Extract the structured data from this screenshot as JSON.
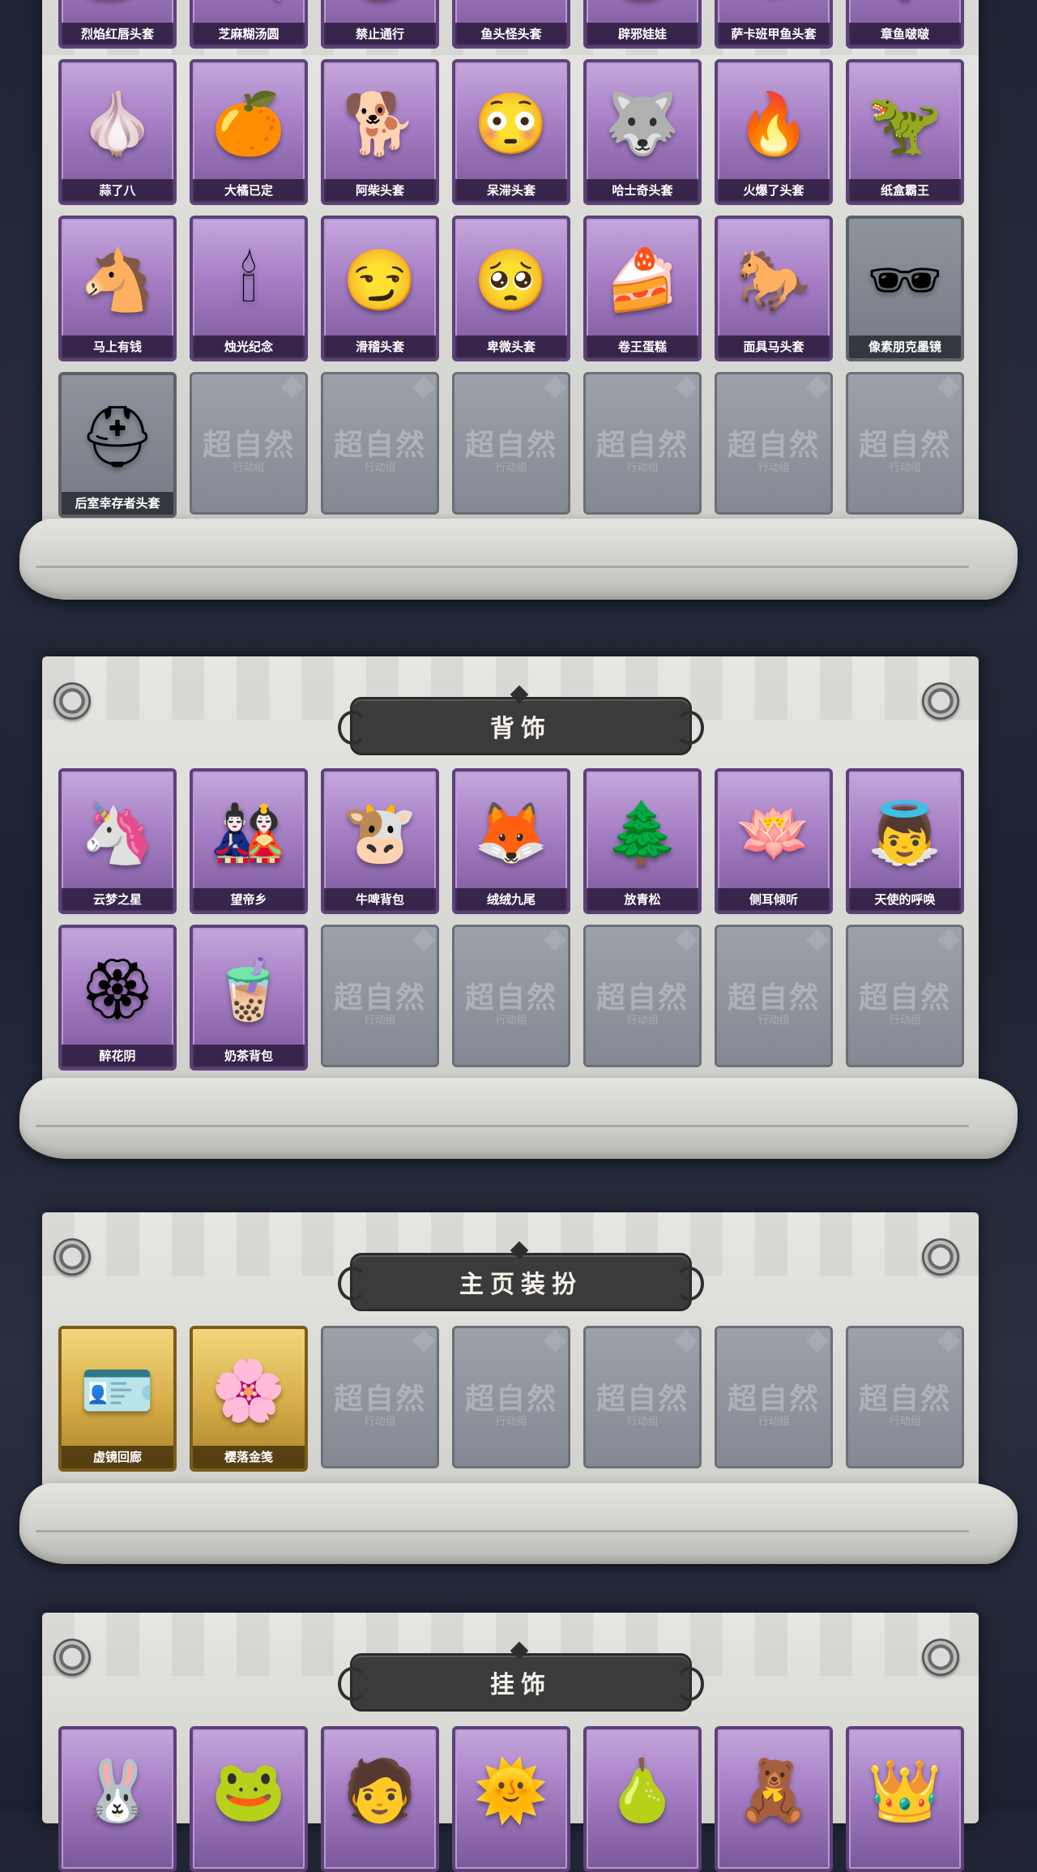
{
  "watermark": {
    "brand": "超自然",
    "sub": "行动组"
  },
  "sections": [
    {
      "id": "headgear",
      "rows": [
        [
          {
            "label": "烈焰红唇头套",
            "icon": "lips-icon",
            "glyph": "💋",
            "rarity": "purple"
          },
          {
            "label": "芝麻糊汤圆",
            "icon": "dumpling-icon",
            "glyph": "🍡",
            "rarity": "purple"
          },
          {
            "label": "禁止通行",
            "icon": "no-entry-icon",
            "glyph": "⛔",
            "rarity": "purple"
          },
          {
            "label": "鱼头怪头套",
            "icon": "fish-icon",
            "glyph": "🐟",
            "rarity": "purple"
          },
          {
            "label": "辟邪娃娃",
            "icon": "doll-icon",
            "glyph": "🪆",
            "rarity": "purple"
          },
          {
            "label": "萨卡班甲鱼头套",
            "icon": "fish-head-icon",
            "glyph": "🐠",
            "rarity": "purple"
          },
          {
            "label": "章鱼啵啵",
            "icon": "octopus-icon",
            "glyph": "🐙",
            "rarity": "purple"
          }
        ],
        [
          {
            "label": "蒜了八",
            "icon": "garlic-icon",
            "glyph": "🧄",
            "rarity": "purple"
          },
          {
            "label": "大橘已定",
            "icon": "orange-icon",
            "glyph": "🍊",
            "rarity": "purple"
          },
          {
            "label": "阿柴头套",
            "icon": "shiba-icon",
            "glyph": "🐕",
            "rarity": "purple"
          },
          {
            "label": "呆滞头套",
            "icon": "dazed-face-icon",
            "glyph": "😳",
            "rarity": "purple"
          },
          {
            "label": "哈士奇头套",
            "icon": "husky-icon",
            "glyph": "🐺",
            "rarity": "purple"
          },
          {
            "label": "火爆了头套",
            "icon": "fire-icon",
            "glyph": "🔥",
            "rarity": "purple"
          },
          {
            "label": "纸盒霸王",
            "icon": "dinosaur-icon",
            "glyph": "🦖",
            "rarity": "purple"
          }
        ],
        [
          {
            "label": "马上有钱",
            "icon": "horse-icon",
            "glyph": "🐴",
            "rarity": "purple"
          },
          {
            "label": "烛光纪念",
            "icon": "candle-icon",
            "glyph": "🕯",
            "rarity": "purple"
          },
          {
            "label": "滑稽头套",
            "icon": "funny-face-icon",
            "glyph": "😏",
            "rarity": "purple"
          },
          {
            "label": "卑微头套",
            "icon": "humble-face-icon",
            "glyph": "🥺",
            "rarity": "purple"
          },
          {
            "label": "卷王蛋糕",
            "icon": "cake-roll-icon",
            "glyph": "🍰",
            "rarity": "purple"
          },
          {
            "label": "面具马头套",
            "icon": "horse-mask-icon",
            "glyph": "🐎",
            "rarity": "purple"
          },
          {
            "label": "像素朋克墨镜",
            "icon": "pixel-glasses-icon",
            "glyph": "🕶",
            "rarity": "gray"
          }
        ],
        [
          {
            "label": "后室幸存者头套",
            "icon": "gas-mask-icon",
            "glyph": "⛑",
            "rarity": "gray"
          },
          {
            "rarity": "empty"
          },
          {
            "rarity": "empty"
          },
          {
            "rarity": "empty"
          },
          {
            "rarity": "empty"
          },
          {
            "rarity": "empty"
          },
          {
            "rarity": "empty"
          }
        ]
      ]
    },
    {
      "id": "back",
      "title": "背饰",
      "rows": [
        [
          {
            "label": "云梦之星",
            "icon": "unicorn-icon",
            "glyph": "🦄",
            "rarity": "purple"
          },
          {
            "label": "望帝乡",
            "icon": "figure-icon",
            "glyph": "🎎",
            "rarity": "purple"
          },
          {
            "label": "牛啤背包",
            "icon": "cow-barrel-icon",
            "glyph": "🐮",
            "rarity": "purple"
          },
          {
            "label": "绒绒九尾",
            "icon": "fox-icon",
            "glyph": "🦊",
            "rarity": "purple"
          },
          {
            "label": "放青松",
            "icon": "pine-tree-icon",
            "glyph": "🌲",
            "rarity": "purple"
          },
          {
            "label": "侧耳倾听",
            "icon": "lotus-wreath-icon",
            "glyph": "🪷",
            "rarity": "purple"
          },
          {
            "label": "天使的呼唤",
            "icon": "angel-icon",
            "glyph": "👼",
            "rarity": "purple"
          }
        ],
        [
          {
            "label": "醉花阴",
            "icon": "flower-ornament-icon",
            "glyph": "🏵",
            "rarity": "purple"
          },
          {
            "label": "奶茶背包",
            "icon": "milk-tea-icon",
            "glyph": "🧋",
            "rarity": "purple"
          },
          {
            "rarity": "empty"
          },
          {
            "rarity": "empty"
          },
          {
            "rarity": "empty"
          },
          {
            "rarity": "empty"
          },
          {
            "rarity": "empty"
          }
        ]
      ]
    },
    {
      "id": "homepage",
      "title": "主页装扮",
      "rows": [
        [
          {
            "label": "虚镜回廊",
            "icon": "purple-card-icon",
            "glyph": "🪪",
            "rarity": "gold"
          },
          {
            "label": "樱落金笺",
            "icon": "pink-card-icon",
            "glyph": "🌸",
            "rarity": "gold"
          },
          {
            "rarity": "empty"
          },
          {
            "rarity": "empty"
          },
          {
            "rarity": "empty"
          },
          {
            "rarity": "empty"
          },
          {
            "rarity": "empty"
          }
        ]
      ]
    },
    {
      "id": "pendant",
      "title": "挂饰",
      "rows": [
        [
          {
            "label": "",
            "icon": "white-creature-pendant-icon",
            "glyph": "🐰",
            "rarity": "purple"
          },
          {
            "label": "",
            "icon": "green-creature-pendant-icon",
            "glyph": "🐸",
            "rarity": "purple"
          },
          {
            "label": "",
            "icon": "dark-hair-pendant-icon",
            "glyph": "🧑",
            "rarity": "purple"
          },
          {
            "label": "",
            "icon": "sun-hair-pendant-icon",
            "glyph": "🌞",
            "rarity": "purple"
          },
          {
            "label": "",
            "icon": "green-bag-pendant-icon",
            "glyph": "🍐",
            "rarity": "purple"
          },
          {
            "label": "",
            "icon": "bear-pendant-icon",
            "glyph": "🧸",
            "rarity": "purple"
          },
          {
            "label": "",
            "icon": "crown-pendant-icon",
            "glyph": "👑",
            "rarity": "purple"
          }
        ]
      ]
    }
  ]
}
